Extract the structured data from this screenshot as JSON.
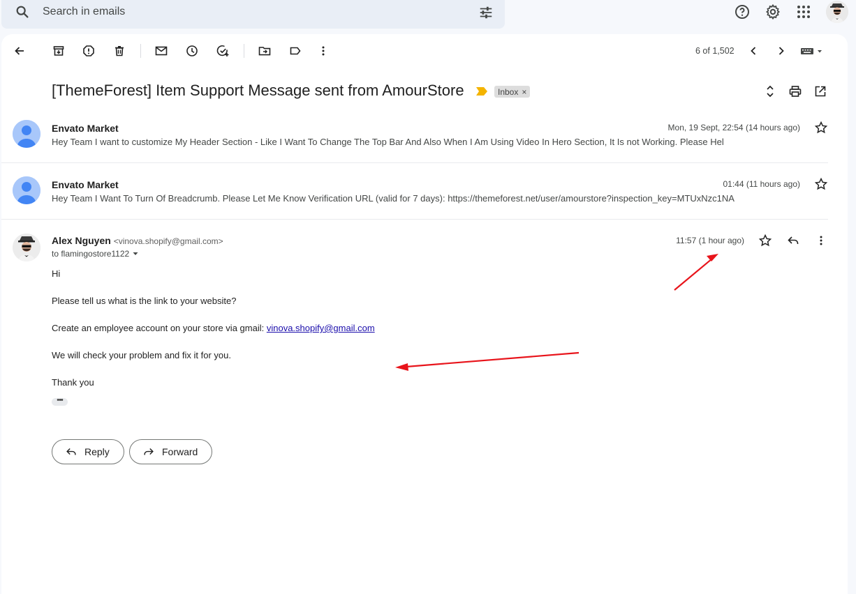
{
  "search": {
    "placeholder": "Search in emails"
  },
  "toolbar": {
    "count": "6 of 1,502"
  },
  "thread": {
    "subject": "[ThemeForest] Item Support Message sent from AmourStore",
    "label": "Inbox",
    "label_close": "×"
  },
  "messages": [
    {
      "from": "Envato Market",
      "date": "Mon, 19 Sept, 22:54 (14 hours ago)",
      "snippet": "Hey Team I want to customize My Header Section - Like I Want To Change The Top Bar And Also When I Am Using Video In Hero Section, It Is not Working. Please Hel"
    },
    {
      "from": "Envato Market",
      "date": "01:44 (11 hours ago)",
      "snippet": "Hey Team I Want To Turn Of Breadcrumb. Please Let Me Know Verification URL (valid for 7 days): https://themeforest.net/user/amourstore?inspection_key=MTUxNzc1NA"
    }
  ],
  "open_message": {
    "from": "Alex Nguyen",
    "email": "<vinova.shopify@gmail.com>",
    "date": "11:57 (1 hour ago)",
    "to": "to flamingostore1122",
    "body": {
      "greeting": "Hi",
      "line1": "Please tell us what is the link to your website?",
      "line2_prefix": "Create an employee account on your store via gmail: ",
      "line2_link": "vinova.shopify@gmail.com",
      "line3": "We will check your problem and fix it for you.",
      "closing": "Thank you"
    },
    "trimmed": "•••"
  },
  "actions": {
    "reply": "Reply",
    "forward": "Forward"
  },
  "colors": {
    "accent": "#0b57d0",
    "annotation": "#e8141b",
    "important": "#f4b400"
  }
}
